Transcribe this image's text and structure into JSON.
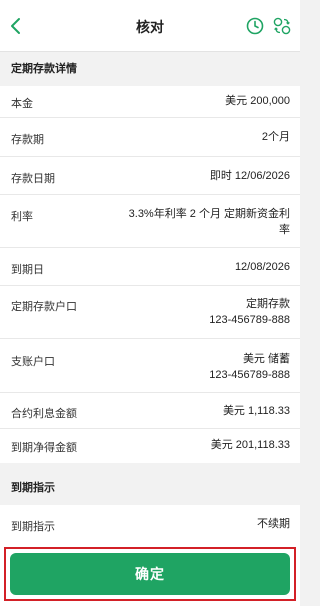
{
  "colors": {
    "accent_green": "#1fa463",
    "highlight_red": "#d32027",
    "background": "#f2f2f2"
  },
  "header": {
    "title": "核对",
    "back_icon": "chevron-left-icon",
    "history_icon": "clock-icon",
    "swap_icon": "currency-exchange-icon"
  },
  "details": {
    "section_title": "定期存款详情",
    "principal_label": "本金",
    "principal_value": "美元  200,000",
    "term_label": "存款期",
    "term_value": "2个月",
    "deposit_date_label": "存款日期",
    "deposit_date_value": "即时 12/06/2026",
    "rate_label": "利率",
    "rate_value_line1": "3.3%年利率 2 个月 定期新资金利",
    "rate_value_line2": "率",
    "maturity_date_label": "到期日",
    "maturity_date_value": "12/08/2026",
    "deposit_account_label": "定期存款户口",
    "deposit_account_line1": "定期存款",
    "deposit_account_line2": "123-456789-888",
    "payment_account_label": "支账户口",
    "payment_account_line1": "美元 储蓄",
    "payment_account_line2": "123-456789-888",
    "interest_label": "合约利息金额",
    "interest_value": "美元  1,118.33",
    "net_label": "到期净得金额",
    "net_value": "美元  201,118.33"
  },
  "maturity": {
    "section_title": "到期指示",
    "instruction_label": "到期指示",
    "instruction_value": "不续期"
  },
  "confirm_label": "确定"
}
